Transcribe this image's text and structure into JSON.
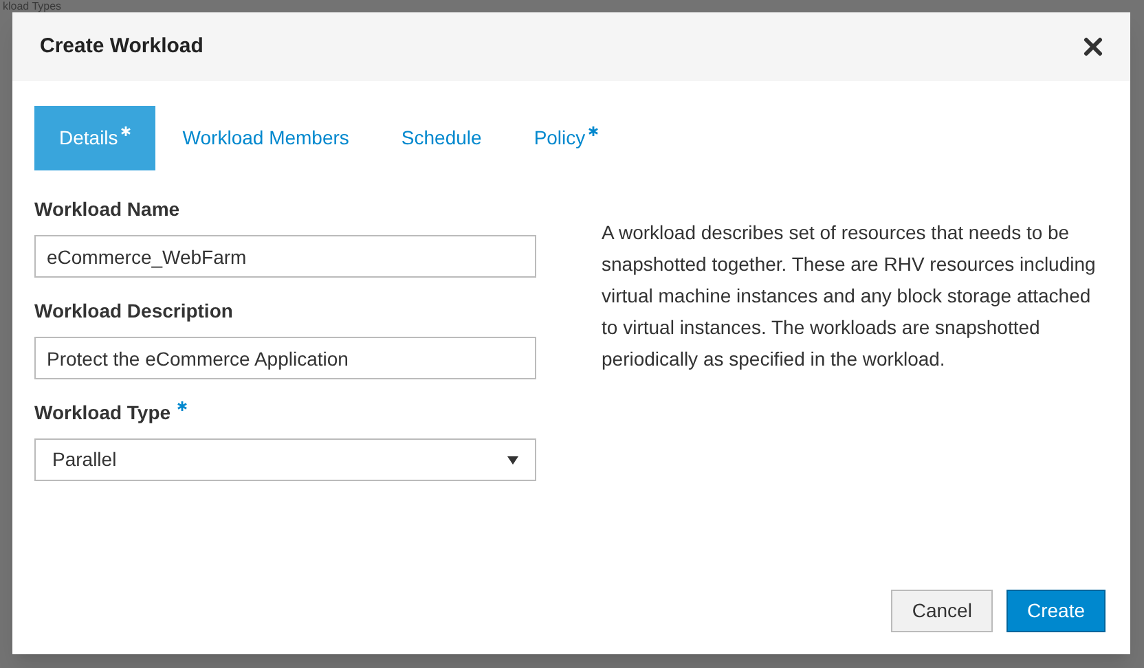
{
  "background_page": {
    "title": "kload Types"
  },
  "dialog": {
    "title": "Create Workload",
    "tabs": [
      {
        "label": "Details",
        "selected": true,
        "required": true
      },
      {
        "label": "Workload Members",
        "selected": false,
        "required": false
      },
      {
        "label": "Schedule",
        "selected": false,
        "required": false
      },
      {
        "label": "Policy",
        "selected": false,
        "required": true
      }
    ],
    "fields": [
      {
        "kind": "text",
        "label": "Workload Name",
        "required": false,
        "value": "eCommerce_WebFarm"
      },
      {
        "kind": "text",
        "label": "Workload Description",
        "required": false,
        "value": "Protect the eCommerce Application"
      },
      {
        "kind": "select",
        "label": "Workload Type",
        "required": true,
        "value": "Parallel"
      }
    ],
    "help_text": "A workload describes set of resources that needs to be snapshotted together. These are RHV resources including virtual machine instances and any block storage attached to virtual instances. The workloads are snapshotted periodically as specified in the workload.",
    "buttons": [
      {
        "label": "Cancel",
        "kind": "default"
      },
      {
        "label": "Create",
        "kind": "primary"
      }
    ]
  }
}
